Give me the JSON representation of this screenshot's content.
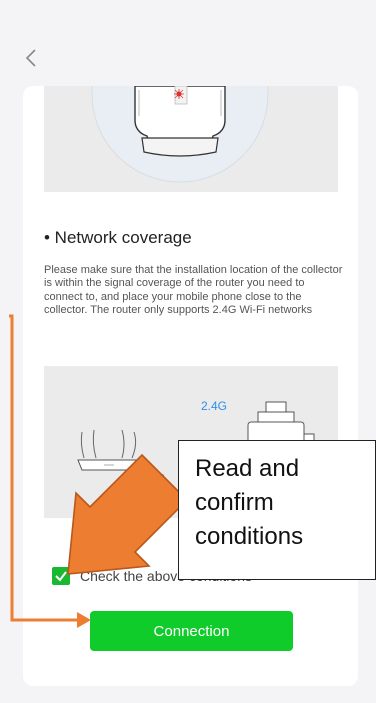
{
  "nav": {
    "back_icon": "chevron-left-icon"
  },
  "illustration_top": {
    "icon": "collector-device-image"
  },
  "section": {
    "title": "• Network coverage",
    "description": "Please make sure that the installation location of the collector is within the signal coverage of the router you need to connect to, and place your mobile phone close to the collector. The router only supports 2.4G Wi-Fi networks"
  },
  "illustration_network": {
    "band_label": "2.4G"
  },
  "confirm": {
    "checked": true,
    "label": "Check the above conditions"
  },
  "connect_button": {
    "label": "Connection"
  },
  "annotation": {
    "callout_lines": [
      "Read and",
      "confirm",
      "conditions"
    ],
    "arrow_color": "#ed7d31"
  },
  "colors": {
    "accent_green": "#10cc2a",
    "checkbox_green": "#18b830",
    "annotation_orange": "#ed7d31"
  }
}
